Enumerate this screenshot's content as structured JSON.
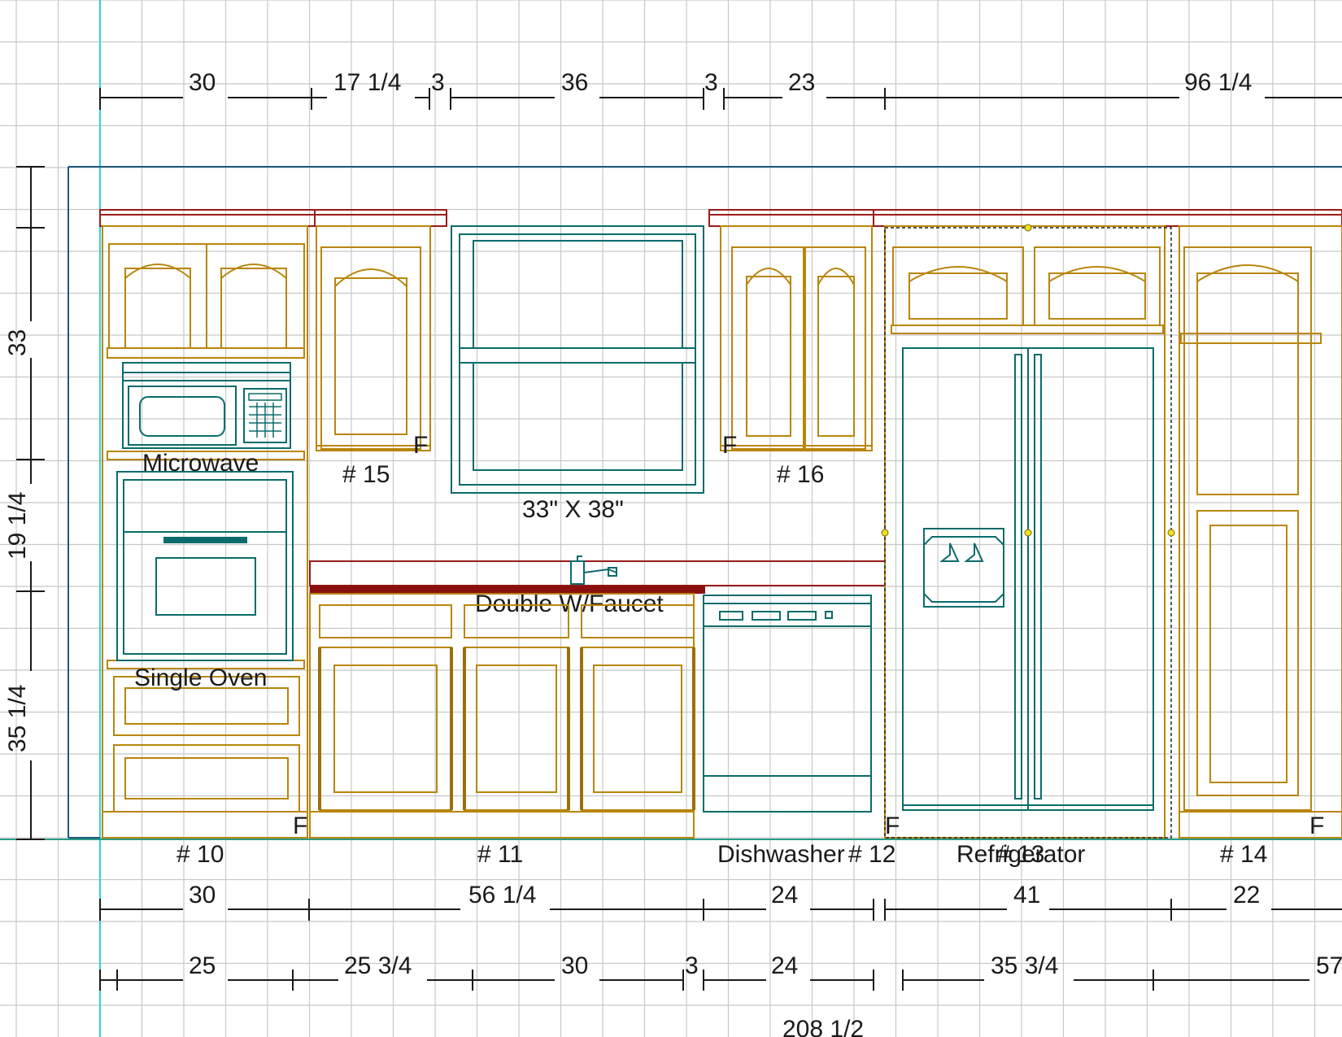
{
  "dimensions": {
    "top_row": [
      "30",
      "17 1/4",
      "3",
      "36",
      "3",
      "23",
      "96 1/4"
    ],
    "left_col": [
      "33",
      "19 1/4",
      "35 1/4"
    ],
    "bottom_row1": [
      "30",
      "56 1/4",
      "24",
      "41",
      "22"
    ],
    "bottom_row2": [
      "25",
      "25 3/4",
      "30",
      "3",
      "24",
      "35 3/4",
      "57"
    ],
    "total": "208 1/2"
  },
  "labels": {
    "microwave": "Microwave",
    "single_oven": "Single Oven",
    "window": "33\" X 38\"",
    "sink": "Double W/Faucet",
    "dishwasher": "Dishwasher",
    "refrigerator": "Refrigerator"
  },
  "cabinet_numbers": {
    "c10": "# 10",
    "c11": "# 11",
    "c12": "# 12",
    "c13": "# 13",
    "c14": "# 14",
    "c15": "# 15",
    "c16": "# 16"
  },
  "filler_marker": "F",
  "colors": {
    "cabinet": "#b8860b",
    "cabinet_dark": "#9c6f0a",
    "crown": "#9b1b1b",
    "appliance": "#0b6b6b",
    "grid": "#c8c8c8",
    "wall": "#1f5a7a",
    "dimension": "#1a1a1a"
  }
}
